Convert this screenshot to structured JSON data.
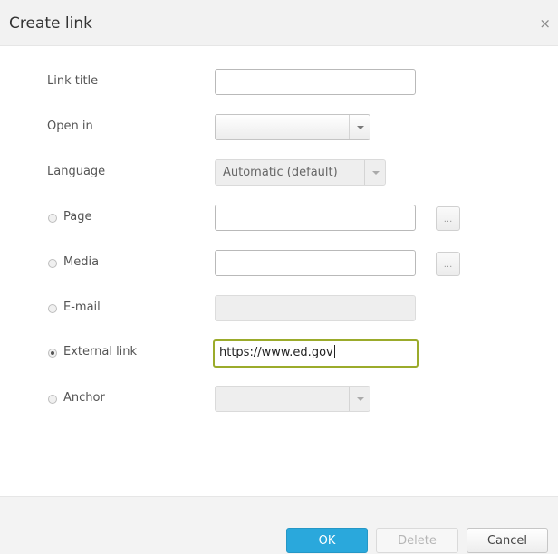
{
  "dialog": {
    "title": "Create link",
    "close_glyph": "×"
  },
  "form": {
    "link_title": {
      "label": "Link title",
      "value": ""
    },
    "open_in": {
      "label": "Open in",
      "value": ""
    },
    "language": {
      "label": "Language",
      "value": "Automatic (default)"
    },
    "page": {
      "label": "Page",
      "value": "",
      "browse_label": "..."
    },
    "media": {
      "label": "Media",
      "value": "",
      "browse_label": "..."
    },
    "email": {
      "label": "E-mail",
      "value": ""
    },
    "external_link": {
      "label": "External link",
      "value": "https://www.ed.gov",
      "selected": true
    },
    "anchor": {
      "label": "Anchor",
      "value": ""
    }
  },
  "footer": {
    "ok_label": "OK",
    "delete_label": "Delete",
    "cancel_label": "Cancel"
  },
  "colors": {
    "ok_button": "#2aa8dc",
    "focus_border": "#9bab2b"
  }
}
